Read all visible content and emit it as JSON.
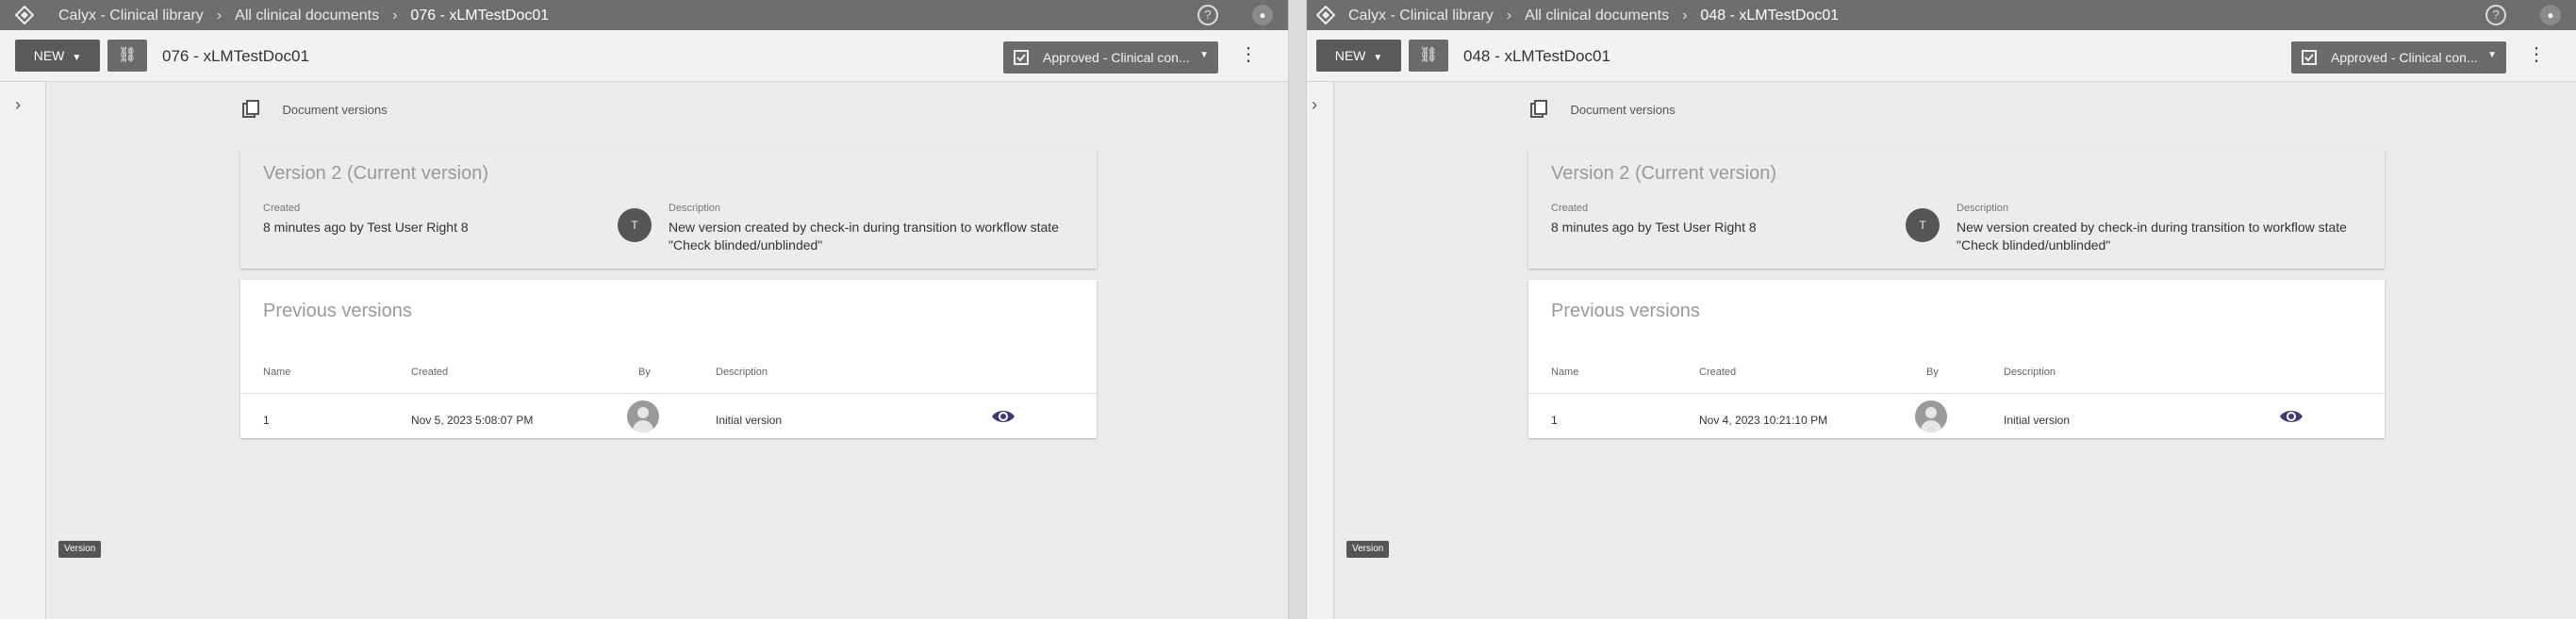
{
  "left": {
    "breadcrumbs": [
      "Calyx - Clinical library",
      "All clinical documents",
      "076 - xLMTestDoc01"
    ],
    "new_label": "NEW",
    "doc_title": "076 - xLMTestDoc01",
    "status_label": "Approved - Clinical con...",
    "section_label": "Document versions",
    "current": {
      "heading": "Version 2 (Current version)",
      "created_label": "Created",
      "created_value": "8 minutes ago by Test User Right 8",
      "avatar_initial": "T",
      "description_label": "Description",
      "description_value": "New version created by check-in during transition to workflow state \"Check blinded/unblinded\""
    },
    "previous": {
      "heading": "Previous versions",
      "columns": [
        "Name",
        "Created",
        "By",
        "Description"
      ],
      "rows": [
        {
          "name": "1",
          "created": "Nov 5, 2023 5:08:07 PM",
          "description": "Initial version"
        }
      ]
    },
    "version_pill": "Version"
  },
  "right": {
    "breadcrumbs": [
      "Calyx - Clinical library",
      "All clinical documents",
      "048 - xLMTestDoc01"
    ],
    "new_label": "NEW",
    "doc_title": "048 - xLMTestDoc01",
    "status_label": "Approved - Clinical con...",
    "section_label": "Document versions",
    "current": {
      "heading": "Version 2 (Current version)",
      "created_label": "Created",
      "created_value": "8 minutes ago by Test User Right 8",
      "avatar_initial": "T",
      "description_label": "Description",
      "description_value": "New version created by check-in during transition to workflow state \"Check blinded/unblinded\""
    },
    "previous": {
      "heading": "Previous versions",
      "columns": [
        "Name",
        "Created",
        "By",
        "Description"
      ],
      "rows": [
        {
          "name": "1",
          "created": "Nov 4, 2023 10:21:10 PM",
          "description": "Initial version"
        }
      ]
    },
    "version_pill": "Version"
  },
  "colors": {
    "topbar": "#6e6e6e",
    "primary_button": "#5a5a5a",
    "status_button": "#6b6b6b",
    "eye_icon": "#3d3a7a"
  },
  "icons": [
    "logo-icon",
    "help-icon",
    "user-icon",
    "link-icon",
    "status-icon",
    "more-vert-icon",
    "chevron-right-icon",
    "document-versions-icon",
    "eye-icon"
  ]
}
